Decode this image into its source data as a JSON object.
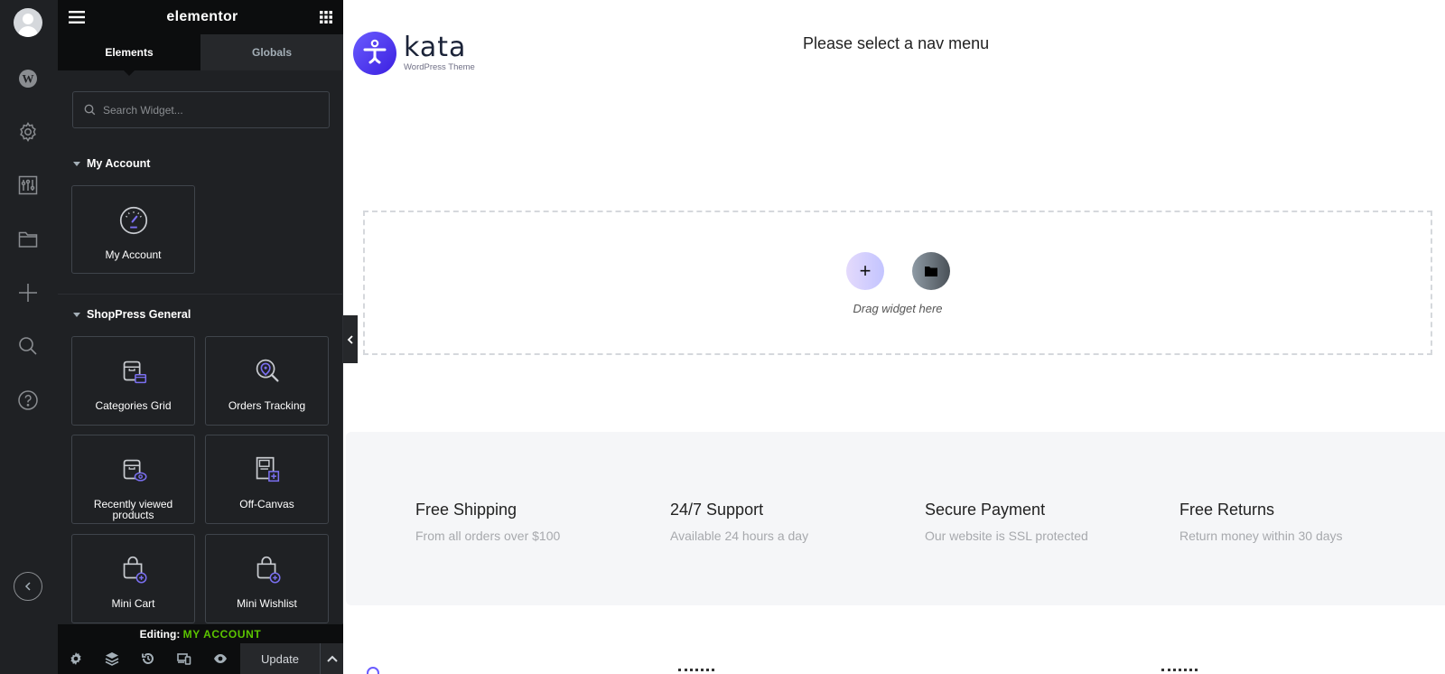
{
  "app": {
    "brand": "elementor"
  },
  "rail": {
    "icons": [
      "avatar",
      "wordpress-icon",
      "gear-icon",
      "sliders-icon",
      "folder-icon",
      "plus-icon",
      "search-icon",
      "help-icon"
    ],
    "collapse_icon": "chevron-left-icon"
  },
  "panel": {
    "tabs": [
      {
        "label": "Elements",
        "active": true
      },
      {
        "label": "Globals",
        "active": false
      }
    ],
    "search": {
      "placeholder": "Search Widget...",
      "value": ""
    },
    "categories": [
      {
        "title": "My Account",
        "widgets": [
          {
            "label": "My Account",
            "icon": "dashboard-gauge-icon"
          }
        ]
      },
      {
        "title": "ShopPress General",
        "widgets": [
          {
            "label": "Categories Grid",
            "icon": "box-folder-icon"
          },
          {
            "label": "Orders Tracking",
            "icon": "location-search-icon"
          },
          {
            "label": "Recently viewed products",
            "icon": "box-eye-icon"
          },
          {
            "label": "Off-Canvas",
            "icon": "panel-plus-icon"
          },
          {
            "label": "Mini Cart",
            "icon": "bag-plus-icon"
          },
          {
            "label": "Mini Wishlist",
            "icon": "bag-plus-icon"
          }
        ]
      }
    ],
    "editing": {
      "prefix": "Editing:",
      "document": "MY ACCOUNT"
    },
    "footer": {
      "buttons": [
        "settings-icon",
        "navigator-layers-icon",
        "history-icon",
        "responsive-icon",
        "preview-eye-icon"
      ],
      "update_label": "Update"
    },
    "colors": {
      "accent_green": "#5bc400",
      "icon_accent": "#7a6ff0"
    }
  },
  "canvas": {
    "logo": {
      "brand": "kata",
      "tagline": "WordPress Theme"
    },
    "nav_message": "Please select a nav menu",
    "drop_zone": {
      "hint": "Drag widget here"
    },
    "features": [
      {
        "title": "Free Shipping",
        "subtitle": "From all orders over $100"
      },
      {
        "title": "24/7 Support",
        "subtitle": "Available 24 hours a day"
      },
      {
        "title": "Secure Payment",
        "subtitle": "Our website is SSL protected"
      },
      {
        "title": "Free Returns",
        "subtitle": "Return money within 30 days"
      }
    ]
  }
}
